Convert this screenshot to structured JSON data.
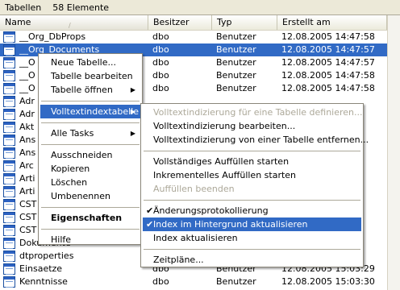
{
  "status": {
    "label": "Tabellen",
    "count": "58 Elemente"
  },
  "columns": {
    "name": "Name",
    "owner": "Besitzer",
    "type": "Typ",
    "created": "Erstellt am"
  },
  "rows": [
    {
      "name": "__Org_DbProps",
      "owner": "dbo",
      "type": "Benutzer",
      "created": "12.08.2005 14:47:58",
      "selected": false
    },
    {
      "name": "__Org_Documents",
      "owner": "dbo",
      "type": "Benutzer",
      "created": "12.08.2005 14:47:57",
      "selected": true
    },
    {
      "name": "__O",
      "owner": "dbo",
      "type": "Benutzer",
      "created": "12.08.2005 14:47:57",
      "selected": false
    },
    {
      "name": "__O",
      "owner": "dbo",
      "type": "Benutzer",
      "created": "12.08.2005 14:47:58",
      "selected": false
    },
    {
      "name": "__O",
      "owner": "dbo",
      "type": "Benutzer",
      "created": "12.08.2005 14:47:58",
      "selected": false
    },
    {
      "name": "Adr",
      "owner": "",
      "type": "",
      "created": "",
      "selected": false
    },
    {
      "name": "Adr",
      "owner": "",
      "type": "",
      "created": "",
      "selected": false
    },
    {
      "name": "Akt",
      "owner": "",
      "type": "",
      "created": "",
      "selected": false
    },
    {
      "name": "Ans",
      "owner": "",
      "type": "",
      "created": "",
      "selected": false
    },
    {
      "name": "Ans",
      "owner": "",
      "type": "",
      "created": "",
      "selected": false
    },
    {
      "name": "Arc",
      "owner": "",
      "type": "",
      "created": "",
      "selected": false
    },
    {
      "name": "Arti",
      "owner": "",
      "type": "",
      "created": "",
      "selected": false
    },
    {
      "name": "Arti",
      "owner": "",
      "type": "",
      "created": "",
      "selected": false
    },
    {
      "name": "CST",
      "owner": "",
      "type": "",
      "created": "",
      "selected": false
    },
    {
      "name": "CST",
      "owner": "",
      "type": "",
      "created": "",
      "selected": false
    },
    {
      "name": "CST",
      "owner": "",
      "type": "",
      "created": "",
      "selected": false
    },
    {
      "name": "Dokumente",
      "owner": "",
      "type": "",
      "created": "",
      "selected": false
    },
    {
      "name": "dtproperties",
      "owner": "",
      "type": "",
      "created": "",
      "selected": false
    },
    {
      "name": "Einsaetze",
      "owner": "dbo",
      "type": "Benutzer",
      "created": "12.08.2005 15:03:29",
      "selected": false
    },
    {
      "name": "Kenntnisse",
      "owner": "dbo",
      "type": "Benutzer",
      "created": "12.08.2005 15:03:30",
      "selected": false
    }
  ],
  "context_menu": [
    {
      "label": "Neue Tabelle...",
      "kind": "item"
    },
    {
      "label": "Tabelle bearbeiten",
      "kind": "item"
    },
    {
      "label": "Tabelle öffnen",
      "kind": "item",
      "submenu": true
    },
    {
      "kind": "sep"
    },
    {
      "label": "Volltextindextabelle",
      "kind": "item",
      "submenu": true,
      "highlighted": true
    },
    {
      "kind": "sep"
    },
    {
      "label": "Alle Tasks",
      "kind": "item",
      "submenu": true
    },
    {
      "kind": "sep"
    },
    {
      "label": "Ausschneiden",
      "kind": "item"
    },
    {
      "label": "Kopieren",
      "kind": "item"
    },
    {
      "label": "Löschen",
      "kind": "item"
    },
    {
      "label": "Umbenennen",
      "kind": "item"
    },
    {
      "kind": "sep"
    },
    {
      "label": "Eigenschaften",
      "kind": "item",
      "bold": true
    },
    {
      "kind": "sep"
    },
    {
      "label": "Hilfe",
      "kind": "item"
    }
  ],
  "submenu": [
    {
      "label": "Volltextindizierung für eine Tabelle definieren...",
      "kind": "item",
      "disabled": true
    },
    {
      "label": "Volltextindizierung bearbeiten...",
      "kind": "item"
    },
    {
      "label": "Volltextindizierung von einer Tabelle entfernen...",
      "kind": "item"
    },
    {
      "kind": "sep"
    },
    {
      "label": "Vollständiges Auffüllen starten",
      "kind": "item"
    },
    {
      "label": "Inkrementelles Auffüllen starten",
      "kind": "item"
    },
    {
      "label": "Auffüllen beenden",
      "kind": "item",
      "disabled": true
    },
    {
      "kind": "sep"
    },
    {
      "label": "Änderungsprotokollierung",
      "kind": "item",
      "checked": true
    },
    {
      "label": "Index im Hintergrund aktualisieren",
      "kind": "item",
      "checked": true,
      "highlighted": true
    },
    {
      "label": "Index aktualisieren",
      "kind": "item"
    },
    {
      "kind": "sep"
    },
    {
      "label": "Zeitpläne...",
      "kind": "item"
    }
  ]
}
